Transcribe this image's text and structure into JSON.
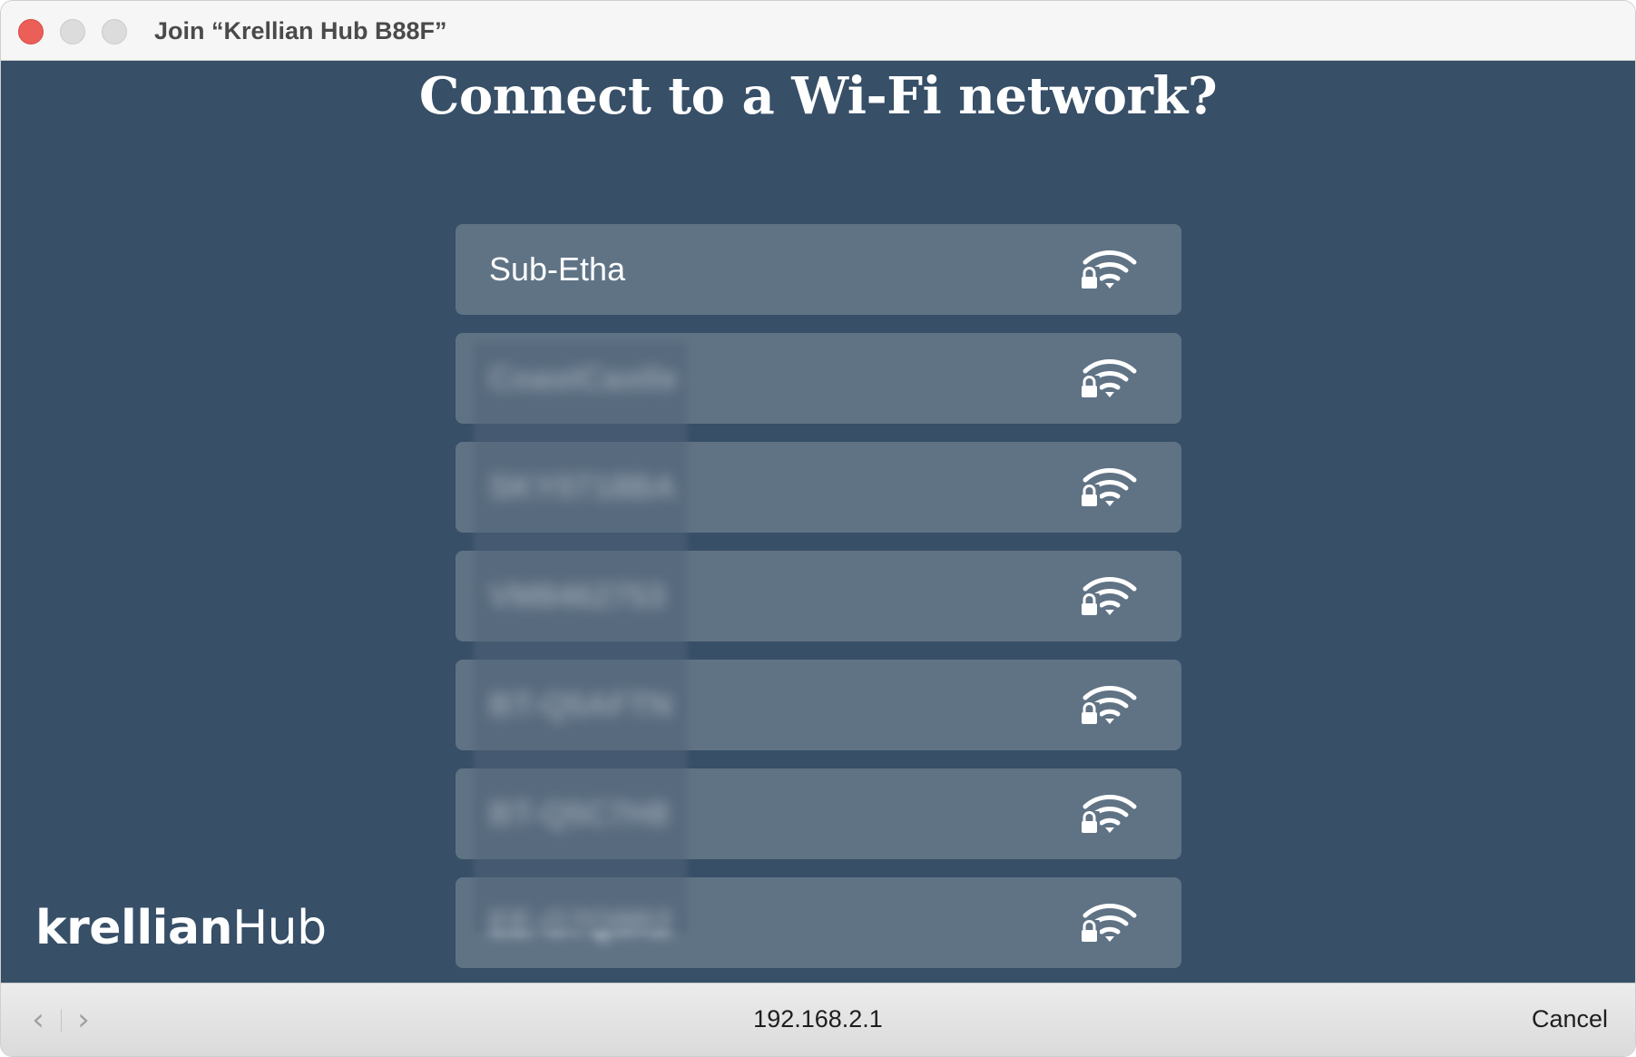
{
  "window": {
    "title": "Join “Krellian Hub B88F”"
  },
  "page": {
    "heading": "Connect to a Wi-Fi network?"
  },
  "networks": [
    {
      "name": "Sub-Etha",
      "blurred": false,
      "secured": true
    },
    {
      "name": "CoastCastle",
      "blurred": true,
      "secured": true
    },
    {
      "name": "SKY0718BA",
      "blurred": true,
      "secured": true
    },
    {
      "name": "VM8462753",
      "blurred": true,
      "secured": true
    },
    {
      "name": "BT-Q5AFTN",
      "blurred": true,
      "secured": true
    },
    {
      "name": "BT-Q5C7H8",
      "blurred": true,
      "secured": true
    },
    {
      "name": "EE-G7Q9R2",
      "blurred": true,
      "secured": true
    }
  ],
  "brand": {
    "part1": "krellian",
    "part2": "Hub"
  },
  "toolbar": {
    "back_glyph": "‹",
    "forward_glyph": "›",
    "address": "192.168.2.1",
    "cancel_label": "Cancel"
  },
  "icons": {
    "network": "wifi-lock-icon",
    "close": "close-window-icon",
    "minimize": "minimize-window-icon",
    "maximize": "maximize-window-icon"
  },
  "colors": {
    "background": "#374f67",
    "list_item": "#607385",
    "close_button": "#ec5f59"
  }
}
